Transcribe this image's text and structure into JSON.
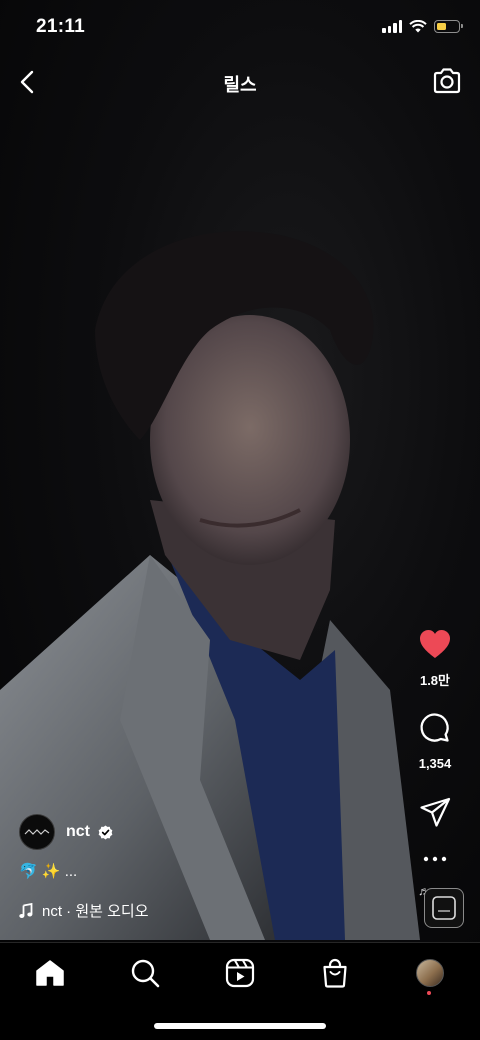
{
  "status": {
    "time": "21:11"
  },
  "nav": {
    "title": "릴스"
  },
  "actions": {
    "likes": "1.8만",
    "comments": "1,354"
  },
  "post": {
    "username": "nct",
    "caption": "🐬 ✨ ...",
    "audio": "nct · 원본 오디오"
  },
  "colors": {
    "like": "#ed4956",
    "battery": "#f7ce46"
  },
  "icons": [
    "back-icon",
    "camera-icon",
    "heart-icon",
    "comment-icon",
    "share-icon",
    "more-icon",
    "music-note-icon",
    "home-icon",
    "search-icon",
    "reels-icon",
    "shop-icon"
  ]
}
